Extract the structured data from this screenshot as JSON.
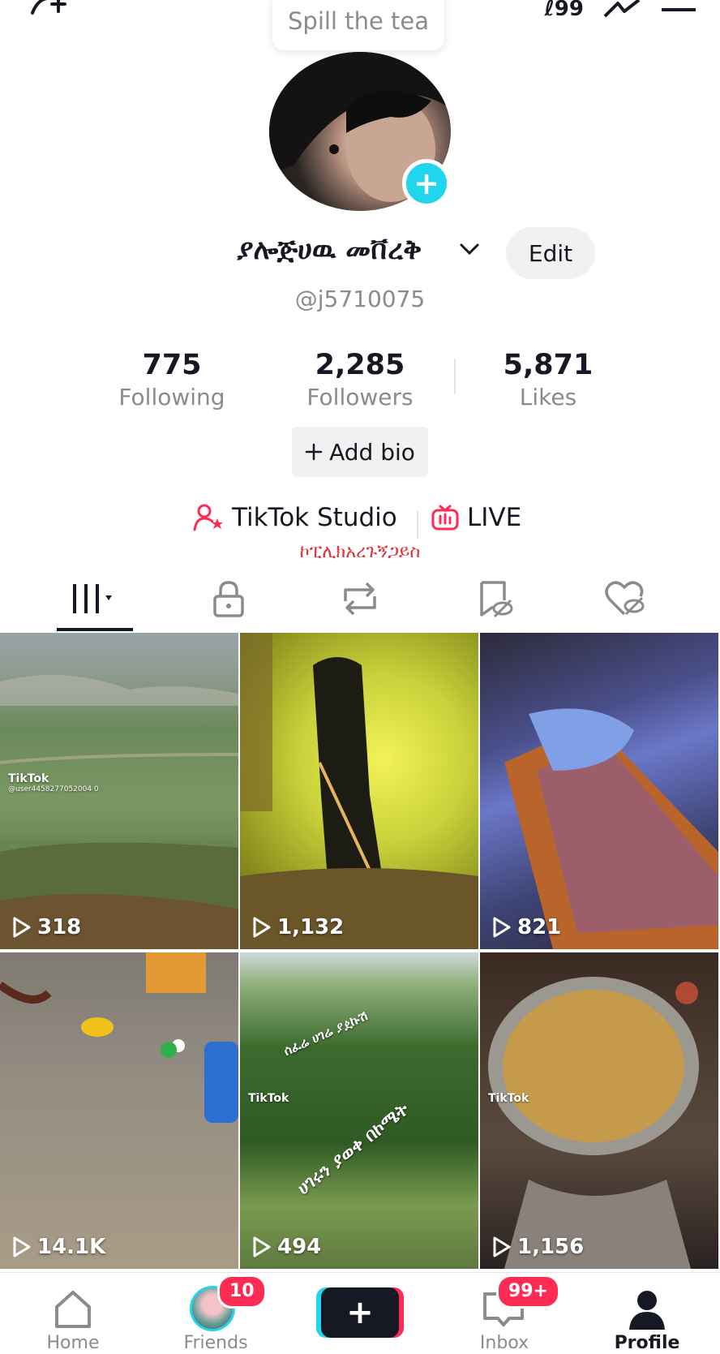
{
  "header": {
    "coins": "ℓ99",
    "note_bubble": "Spill the tea"
  },
  "profile": {
    "display_name": "ያሎጅሀዉ መቨረቅ",
    "handle": "@j5710075",
    "edit_label": "Edit",
    "stats": [
      {
        "value": "775",
        "label": "Following"
      },
      {
        "value": "2,285",
        "label": "Followers"
      },
      {
        "value": "5,871",
        "label": "Likes"
      }
    ],
    "add_bio_label": "Add bio",
    "studio_label": "TikTok Studio",
    "live_label": "LIVE",
    "bio_text": "ኮፒሊክአረጉኝጋይስ"
  },
  "videos": [
    {
      "views": "318",
      "watermark": "TikTok",
      "watermark_user": "@user4458277052004 0"
    },
    {
      "views": "1,132"
    },
    {
      "views": "821"
    },
    {
      "views": "14.1K"
    },
    {
      "views": "494",
      "watermark": "TikTok",
      "overlay_text_1": "ሰፈሬ ሀገሬ ያዸኩሽ",
      "overlay_text_2": "ሀገሩን ያወቀ በኮሜት"
    },
    {
      "views": "1,156",
      "watermark": "TikTok"
    }
  ],
  "nav": {
    "home": "Home",
    "friends": "Friends",
    "friends_badge": "10",
    "inbox": "Inbox",
    "inbox_badge": "99+",
    "profile": "Profile"
  },
  "colors": {
    "accent_red": "#fe2c55",
    "accent_cyan": "#20d5ec",
    "text_primary": "#161823",
    "text_secondary": "#8a8b91"
  }
}
